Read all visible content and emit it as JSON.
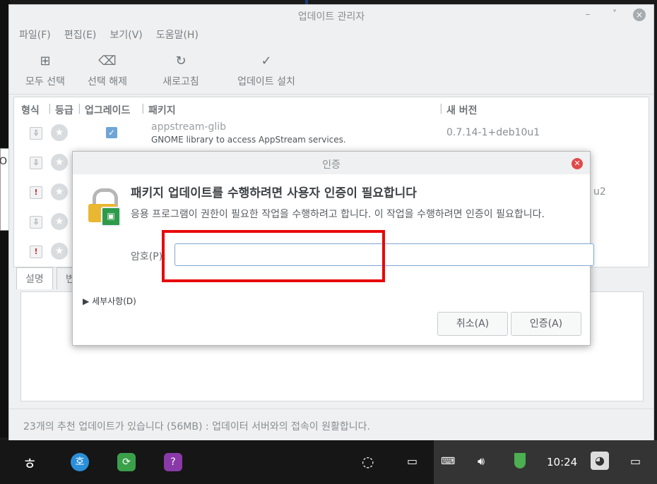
{
  "window": {
    "title": "업데이트 관리자",
    "minimize": "–",
    "maximize": "˅",
    "close": "×"
  },
  "menu": [
    "파일(F)",
    "편집(E)",
    "보기(V)",
    "도움말(H)"
  ],
  "toolbar": {
    "select_all": {
      "label": "모두 선택",
      "icon": "select-all-icon"
    },
    "deselect": {
      "label": "선택 해제",
      "icon": "clear-selection-icon"
    },
    "refresh": {
      "label": "새로고침",
      "icon": "refresh-icon"
    },
    "install": {
      "label": "업데이트 설치",
      "icon": "checkmark-icon"
    }
  },
  "table": {
    "columns": [
      "형식",
      "등급",
      "업그레이드",
      "패키지",
      "새 버전"
    ],
    "rows": [
      {
        "type": "package",
        "name": "appstream-glib",
        "description": "GNOME library to access AppStream services.",
        "version": "0.7.14-1+deb10u1",
        "checked": true
      },
      {
        "type": "package",
        "name": "",
        "description": "",
        "version": "",
        "checked": false
      },
      {
        "type": "security",
        "name": "",
        "description": "",
        "version": "u2",
        "checked": false
      },
      {
        "type": "package",
        "name": "",
        "description": "",
        "version": "",
        "checked": false
      },
      {
        "type": "security",
        "name": "",
        "description": "",
        "version": "",
        "checked": false
      }
    ]
  },
  "tabs": [
    "설명",
    "변"
  ],
  "status_text": "23개의 추천 업데이트가 있습니다 (56MB) : 업데이터 서버와의 접속이 원활합니다.",
  "dialog": {
    "title": "인증",
    "heading": "패키지 업데이트를 수행하려면 사용자 인증이 필요합니다",
    "message": "응용 프로그램이 권한이 필요한 작업을 수행하려고 합니다. 이 작업을 수행하려면 인증이 필요합니다.",
    "password_label": "암호(P):",
    "password_value": "",
    "details": "세부사항(D)",
    "cancel": "취소(A)",
    "authenticate": "인증(A)"
  },
  "desktop_edge_text": "O",
  "taskbar": {
    "clock": "10:24"
  },
  "colors": {
    "accent": "#6fa5d6",
    "highlight_box": "#e8080a",
    "dialog_close": "#e24a4a"
  }
}
